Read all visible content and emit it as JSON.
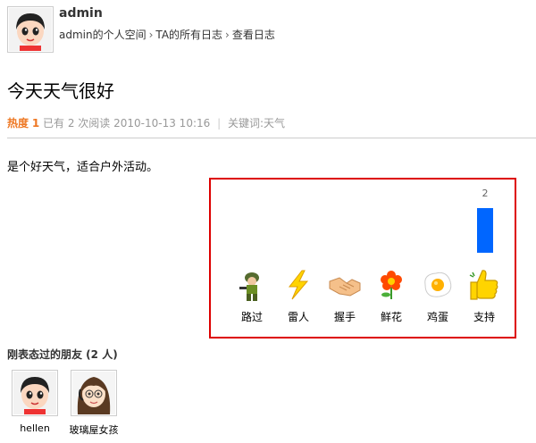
{
  "header": {
    "username": "admin",
    "breadcrumb": [
      "admin的个人空间",
      "TA的所有日志",
      "查看日志"
    ],
    "breadcrumb_sep": "›"
  },
  "post": {
    "title": "今天天气很好",
    "heat_label": "热度",
    "heat_value": "1",
    "reads": "已有 2 次阅读",
    "date": "2010-10-13 10:16",
    "keywords": "关键词:天气",
    "body": "是个好天气，适合户外活动。"
  },
  "reactions": {
    "items": [
      {
        "icon": "soldier-icon",
        "label": "路过",
        "count": 0
      },
      {
        "icon": "lightning-icon",
        "label": "雷人",
        "count": 0
      },
      {
        "icon": "handshake-icon",
        "label": "握手",
        "count": 0
      },
      {
        "icon": "flower-icon",
        "label": "鲜花",
        "count": 0
      },
      {
        "icon": "egg-icon",
        "label": "鸡蛋",
        "count": 0
      },
      {
        "icon": "thumbs-up-icon",
        "label": "支持",
        "count": 2
      }
    ],
    "count_label": "2",
    "bar_color": "#0066ff",
    "border_color": "#dd0000"
  },
  "friends": {
    "title": "刚表态过的朋友 (2 人)",
    "list": [
      {
        "name": "hellen"
      },
      {
        "name": "玻璃屋女孩"
      }
    ]
  },
  "colors": {
    "heat": "#ee7722",
    "meta": "#999999"
  }
}
